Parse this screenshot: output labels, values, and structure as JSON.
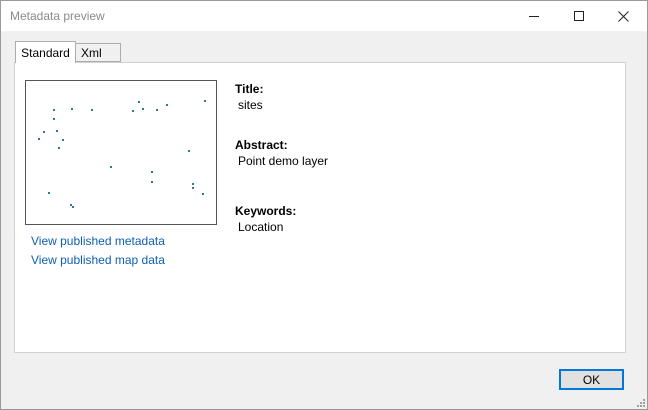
{
  "window": {
    "title": "Metadata preview"
  },
  "tabs": [
    {
      "label": "Standard",
      "active": true
    },
    {
      "label": "Xml",
      "active": false
    }
  ],
  "links": {
    "view_metadata": "View published metadata",
    "view_map_data": "View published map data"
  },
  "fields": {
    "title_label": "Title:",
    "title_value": "sites",
    "abstract_label": "Abstract:",
    "abstract_value": "Point demo layer",
    "keywords_label": "Keywords:",
    "keywords_value": "Location"
  },
  "buttons": {
    "ok_label": "OK"
  },
  "colors": {
    "link": "#0d5fb4",
    "point": "#2a7b8c",
    "focus_border": "#0078d7"
  },
  "icons": {
    "minimize": "minimize-icon",
    "maximize": "maximize-icon",
    "close": "close-icon",
    "resize": "resize-grip-icon"
  }
}
